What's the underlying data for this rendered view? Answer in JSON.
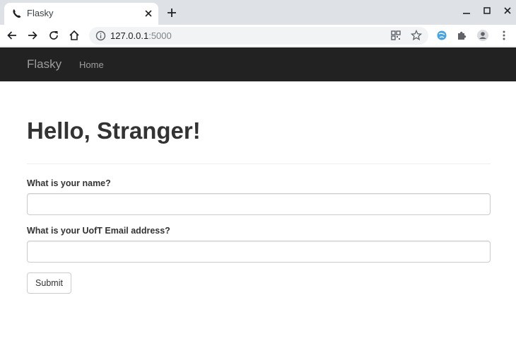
{
  "browser": {
    "tab": {
      "title": "Flasky",
      "favicon": "phone-icon"
    },
    "url": {
      "host": "127.0.0.1",
      "port": ":5000"
    }
  },
  "navbar": {
    "brand": "Flasky",
    "links": [
      {
        "label": "Home"
      }
    ]
  },
  "page": {
    "heading": "Hello, Stranger!",
    "form": {
      "name_label": "What is your name?",
      "name_value": "",
      "email_label": "What is your UofT Email address?",
      "email_value": "",
      "submit_label": "Submit"
    }
  },
  "colors": {
    "navbar_bg": "#222222",
    "navbar_text": "#9d9d9d",
    "tabstrip_bg": "#dee1e6",
    "heading_text": "#333333"
  }
}
